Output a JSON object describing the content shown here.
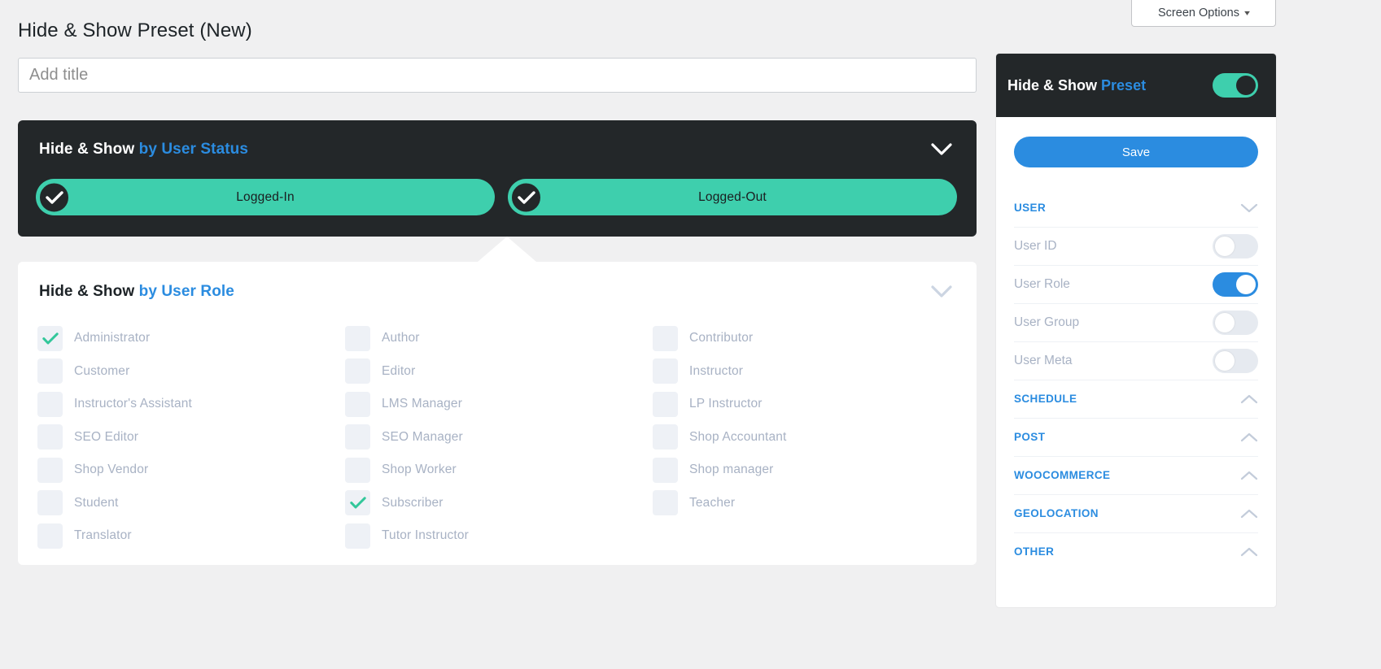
{
  "screen_options": {
    "label": "Screen Options",
    "caret_icon": "caret-down-icon"
  },
  "page": {
    "title": "Hide & Show Preset (New)"
  },
  "title_field": {
    "value": "",
    "placeholder": "Add title"
  },
  "status_card": {
    "heading_main": "Hide & Show",
    "heading_accent": "by User Status",
    "collapse_icon": "chevron-down-icon",
    "options": [
      {
        "label": "Logged-In",
        "checked": true,
        "icon": "check-circle-icon"
      },
      {
        "label": "Logged-Out",
        "checked": true,
        "icon": "check-circle-icon"
      }
    ]
  },
  "role_card": {
    "heading_main": "Hide & Show",
    "heading_accent": "by User Role",
    "collapse_icon": "chevron-down-icon",
    "roles": [
      {
        "label": "Administrator",
        "checked": true
      },
      {
        "label": "Author",
        "checked": false
      },
      {
        "label": "Contributor",
        "checked": false
      },
      {
        "label": "Customer",
        "checked": false
      },
      {
        "label": "Editor",
        "checked": false
      },
      {
        "label": "Instructor",
        "checked": false
      },
      {
        "label": "Instructor's Assistant",
        "checked": false
      },
      {
        "label": "LMS Manager",
        "checked": false
      },
      {
        "label": "LP Instructor",
        "checked": false
      },
      {
        "label": "SEO Editor",
        "checked": false
      },
      {
        "label": "SEO Manager",
        "checked": false
      },
      {
        "label": "Shop Accountant",
        "checked": false
      },
      {
        "label": "Shop Vendor",
        "checked": false
      },
      {
        "label": "Shop Worker",
        "checked": false
      },
      {
        "label": "Shop manager",
        "checked": false
      },
      {
        "label": "Student",
        "checked": false
      },
      {
        "label": "Subscriber",
        "checked": true
      },
      {
        "label": "Teacher",
        "checked": false
      },
      {
        "label": "Translator",
        "checked": false
      },
      {
        "label": "Tutor Instructor",
        "checked": false
      },
      {
        "label": "",
        "checked": false
      }
    ]
  },
  "sidebar": {
    "title_main": "Hide & Show",
    "title_accent": "Preset",
    "master_toggle": {
      "state": "on",
      "color": "#3ecfad"
    },
    "save_label": "Save",
    "rows": [
      {
        "type": "section",
        "label": "USER",
        "control": "chevron-down-icon"
      },
      {
        "type": "item",
        "label": "User ID",
        "toggle": "off"
      },
      {
        "type": "item",
        "label": "User Role",
        "toggle": "on"
      },
      {
        "type": "item",
        "label": "User Group",
        "toggle": "off"
      },
      {
        "type": "item",
        "label": "User Meta",
        "toggle": "off"
      },
      {
        "type": "section",
        "label": "SCHEDULE",
        "control": "chevron-up-icon"
      },
      {
        "type": "section",
        "label": "POST",
        "control": "chevron-up-icon"
      },
      {
        "type": "section",
        "label": "WOOCOMMERCE",
        "control": "chevron-up-icon"
      },
      {
        "type": "section",
        "label": "GEOLOCATION",
        "control": "chevron-up-icon"
      },
      {
        "type": "section",
        "label": "OTHER",
        "control": "chevron-up-icon"
      }
    ]
  },
  "colors": {
    "accent_blue": "#2b8ce0",
    "teal": "#3ecfad",
    "dark": "#232729",
    "muted": "#a8b2c4",
    "page_bg": "#f0f0f1"
  }
}
